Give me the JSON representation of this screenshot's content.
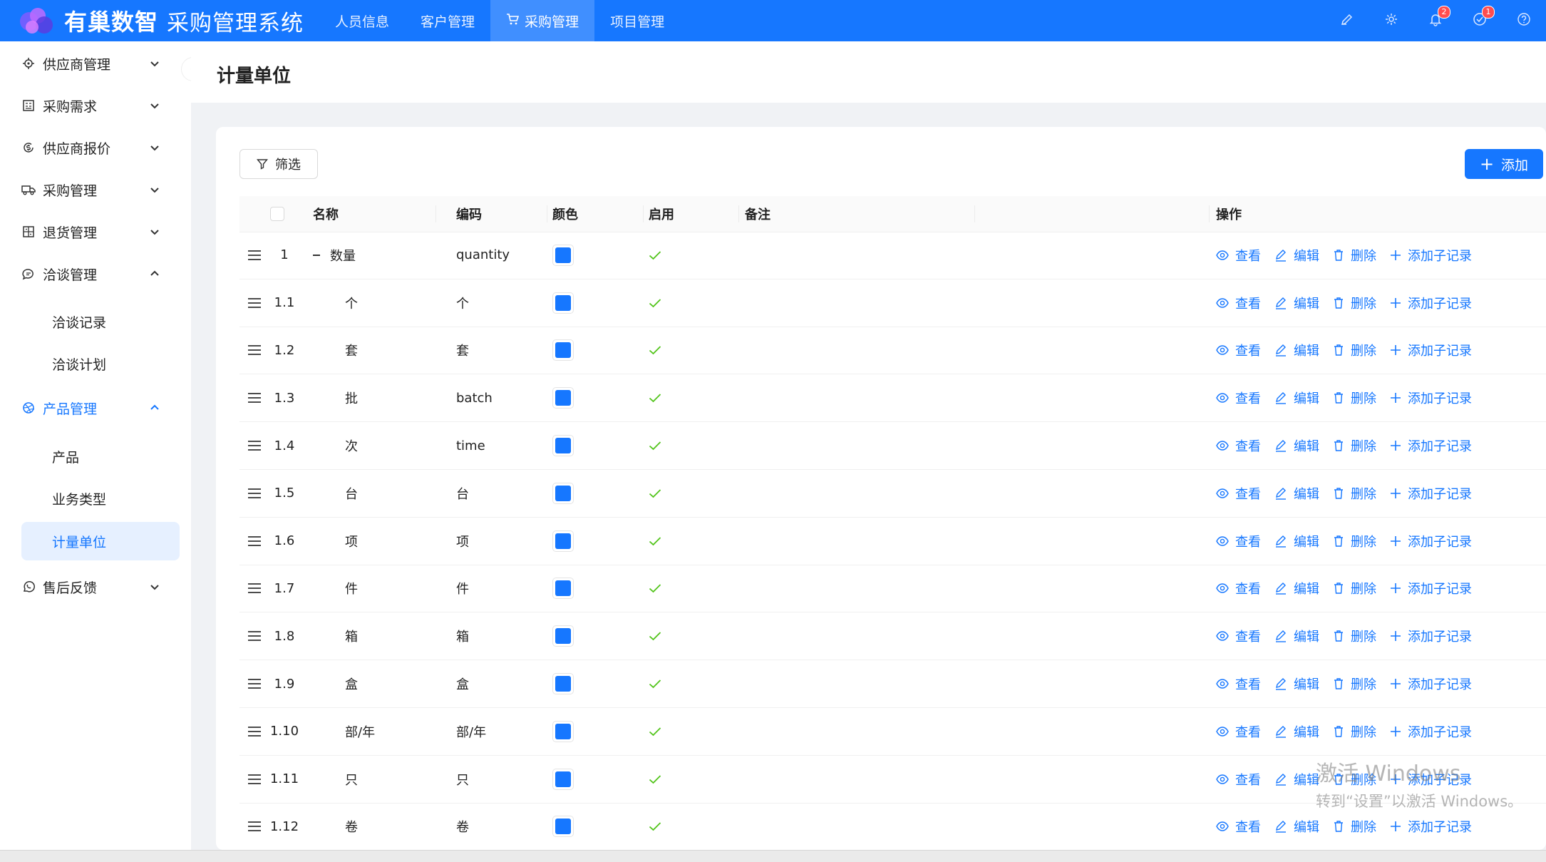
{
  "brand": {
    "company": "有巢数智",
    "system": "采购管理系统"
  },
  "topnav": [
    {
      "label": "人员信息",
      "active": false
    },
    {
      "label": "客户管理",
      "active": false
    },
    {
      "label": "采购管理",
      "active": true
    },
    {
      "label": "项目管理",
      "active": false
    }
  ],
  "topbar": {
    "notifications_count": "2",
    "tasks_count": "1",
    "accent": "#1677ff"
  },
  "sidebar": {
    "items": [
      {
        "label": "供应商管理",
        "icon": "target-icon",
        "expanded": false
      },
      {
        "label": "采购需求",
        "icon": "form-icon",
        "expanded": false
      },
      {
        "label": "供应商报价",
        "icon": "dollar-circle-icon",
        "expanded": false
      },
      {
        "label": "采购管理",
        "icon": "truck-icon",
        "expanded": false
      },
      {
        "label": "退货管理",
        "icon": "return-icon",
        "expanded": false
      },
      {
        "label": "洽谈管理",
        "icon": "chat-icon",
        "expanded": true,
        "children": [
          "洽谈记录",
          "洽谈计划"
        ]
      },
      {
        "label": "产品管理",
        "icon": "dribbble-icon",
        "expanded": true,
        "children": [
          "产品",
          "业务类型",
          "计量单位"
        ],
        "active_child": "计量单位"
      },
      {
        "label": "售后反馈",
        "icon": "whatsapp-icon",
        "expanded": false
      }
    ]
  },
  "page": {
    "title": "计量单位"
  },
  "toolbar": {
    "filter_label": "筛选",
    "add_label": "添加"
  },
  "table": {
    "columns": [
      "名称",
      "编码",
      "颜色",
      "启用",
      "备注",
      "操作"
    ],
    "actions": [
      "查看",
      "编辑",
      "删除",
      "添加子记录"
    ],
    "swatch_color": "#1677ff",
    "check_color": "#52c41a",
    "rows": [
      {
        "seq": "1",
        "name": "数量",
        "code": "quantity",
        "enabled": true,
        "parent": true
      },
      {
        "seq": "1.1",
        "name": "个",
        "code": "个",
        "enabled": true
      },
      {
        "seq": "1.2",
        "name": "套",
        "code": "套",
        "enabled": true
      },
      {
        "seq": "1.3",
        "name": "批",
        "code": "batch",
        "enabled": true
      },
      {
        "seq": "1.4",
        "name": "次",
        "code": "time",
        "enabled": true
      },
      {
        "seq": "1.5",
        "name": "台",
        "code": "台",
        "enabled": true
      },
      {
        "seq": "1.6",
        "name": "项",
        "code": "项",
        "enabled": true
      },
      {
        "seq": "1.7",
        "name": "件",
        "code": "件",
        "enabled": true
      },
      {
        "seq": "1.8",
        "name": "箱",
        "code": "箱",
        "enabled": true
      },
      {
        "seq": "1.9",
        "name": "盒",
        "code": "盒",
        "enabled": true
      },
      {
        "seq": "1.10",
        "name": "部/年",
        "code": "部/年",
        "enabled": true
      },
      {
        "seq": "1.11",
        "name": "只",
        "code": "只",
        "enabled": true
      },
      {
        "seq": "1.12",
        "name": "卷",
        "code": "卷",
        "enabled": true
      }
    ]
  },
  "watermark": {
    "line1": "激活 Windows",
    "line2": "转到“设置”以激活 Windows。"
  }
}
